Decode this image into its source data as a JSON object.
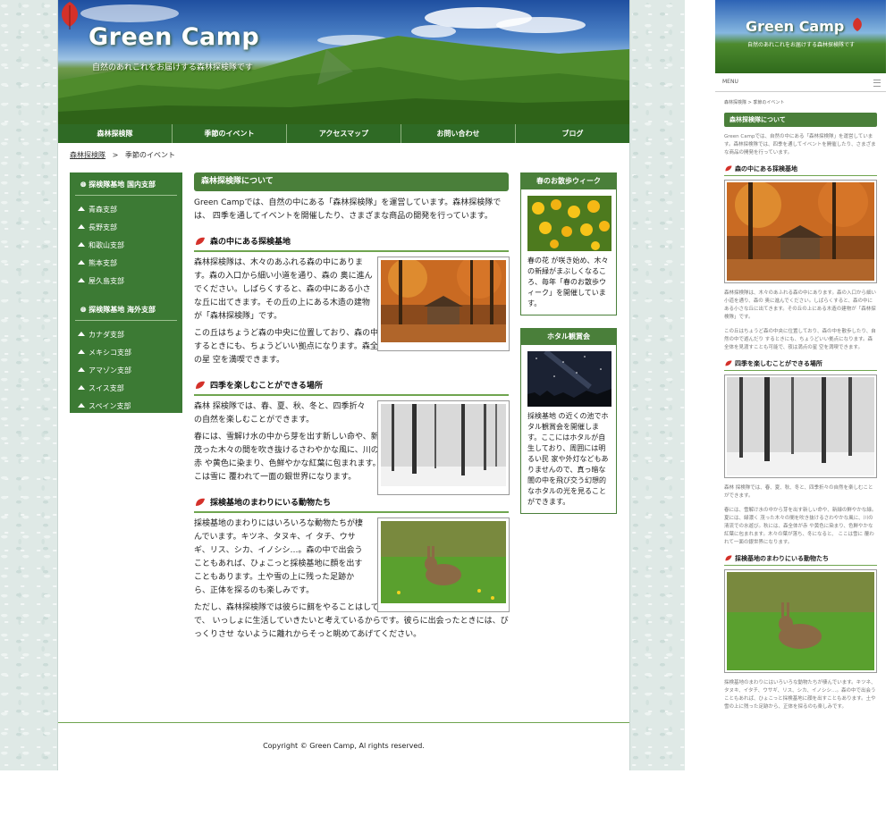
{
  "site": {
    "logo": "Green Camp",
    "tagline": "自然のあれこれをお届けする森林探検隊です"
  },
  "nav": [
    "森林探検隊",
    "季節のイベント",
    "アクセスマップ",
    "お問い合わせ",
    "ブログ"
  ],
  "breadcrumb": {
    "home": "森林探検隊",
    "sep": ">",
    "current": "季節のイベント"
  },
  "sidebar": {
    "domestic_title": "探検隊基地 国内支部",
    "domestic": [
      "青森支部",
      "長野支部",
      "和歌山支部",
      "熊本支部",
      "屋久島支部"
    ],
    "overseas_title": "探検隊基地 海外支部",
    "overseas": [
      "カナダ支部",
      "メキシコ支部",
      "アマゾン支部",
      "スイス支部",
      "スペイン支部"
    ]
  },
  "main": {
    "title": "森林探検隊について",
    "intro": "Green Campでは、自然の中にある「森林探検隊」を運営しています。森林探検隊では、 四季を通してイベントを開催したり、さまざまな商品の開発を行っています。",
    "s1_title": "森の中にある探検基地",
    "s1_p1": "森林探検隊は、木々のあふれる森の中にあります。森の入口から細い小道を通り、森の 奥に進んでください。しばらくすると、森の中にある小さな丘に出てきます。その丘の上にある木造の建物が「森林探検隊」です。",
    "s1_p2": "この丘はちょうど森の中央に位置しており、森の中を散歩したり、自然の中で遊んだり するときにも、ちょうどいい拠点になります。森全体を見渡すことも可能で、夜は満点の星 空を満喫できます。",
    "s2_title": "四季を楽しむことができる場所",
    "s2_p1": "森林 探検隊では、春、夏、秋、冬と、四季折々の自然を楽しむことができます。",
    "s2_p2": "春には、雪解け水の中から芽を出す新しい命や、新緑の鮮やかな緑。夏には、緑濃く 茂った木々の間を吹き抜けるさわやかな風に、川の清流での水遊び。秋には、森全体が赤 や黄色に染まり、色鮮やかな紅葉に包まれます。木々の葉が落ち、冬になると、 ここは雪に 覆われて一面の銀世界になります。",
    "s3_title": "採検基地のまわりにいる動物たち",
    "s3_p1": "採検基地のまわりにはいろいろな動物たちが棲んでいます。キツネ、タヌキ、イ タチ、ウサギ、リス、シカ、イノシシ…。森の中で出会うこともあれば、ひょこっと採検基地に顔を出すこともあります。土や雪の上に残った足跡から、正体を探るのも楽しみです。",
    "s3_p2": "ただし、森林探検隊では彼らに餌をやることはしていません。自然にあるがままの姿で、 いっしょに生活していきたいと考えているからです。彼らに出会ったときには、びっくりさせ ないように離れからそっと眺めてあげてください。"
  },
  "right": {
    "box1_title": "春のお散歩ウィーク",
    "box1_text": "春の花 が咲き始め、木々の新緑がまぶしくなるころ、毎年「春のお散歩ウィーク」を開催しています。",
    "box2_title": "ホタル観賞会",
    "box2_text": "採検基地 の近くの池でホタル観賞会を開催します。ここにはホタルが自生しており、周囲には明るい民 家や外灯などもありませんので、真っ暗な闇の中を飛び交う幻想的なホタルの光を見ることができます。"
  },
  "footer": {
    "copyright": "Copyright © Green Camp, Al rights reserved."
  },
  "mobile": {
    "logo": "Green Camp",
    "tagline": "自然のあれこれをお届けする森林探検隊です",
    "menu": "MENU",
    "crumb": "森林探検隊 > 季節のイベント",
    "title": "森林探検隊について",
    "intro": "Green Campでは、自然の中にある「森林探検隊」を運営しています。森林探検隊では、四季を通してイベントを開催したり、さまざまな商品の開発を行っています。",
    "s1_title": "森の中にある採検基地",
    "s1_p1": "森林探検隊は、木々のあふれる森の中にあります。森の入口から細い小道を通り、森の 奥に進んでください。しばらくすると、森の中にある小さな丘に出てきます。その丘の上にある木造の建物が「森林探検隊」です。",
    "s1_p2": "この丘はちょうど森の中央に位置しており、森の中を散歩したり、自然の中で遊んだり するときにも、ちょうどいい拠点になります。森全体を見渡すことも可能で、夜は満点の星 空を満喫できます。",
    "s2_title": "四季を楽しむことができる場所",
    "s2_p1": "森林 探検隊では、春、夏、秋、冬と、四季折々の自然を楽しむことができます。",
    "s2_p2": "春には、雪解け水の中から芽を出す新しい命や、新緑の鮮やかな緑。夏には、緑濃く 茂った木々の間を吹き抜けるさわやかな風に、川の清流での水遊び。秋には、森全体が赤 や黄色に染まり、色鮮やかな紅葉に包まれます。木々の葉が落ち、冬になると、 ここは雪に 覆われて一面の銀世界になります。",
    "s3_title": "採検基地のまわりにいる動物たち",
    "s3_p1": "採検基地のまわりにはいろいろな動物たちが棲んでいます。キツネ、タヌキ、イタチ、ウサギ、リス、シカ、イノシシ…。森の中で出会うこともあれば、ひょこっと採検基地に顔を出すこともあります。土や雪の上に残った足跡から、正体を探るのも楽しみです。"
  }
}
